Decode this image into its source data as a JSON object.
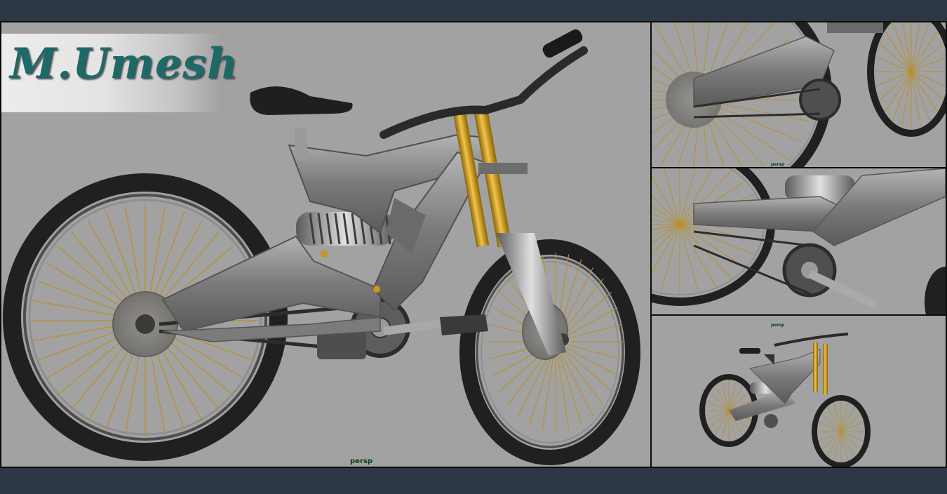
{
  "logo": {
    "text": "M.Umesh"
  },
  "viewports": {
    "main": {
      "camera_label": "persp"
    },
    "top_right": {
      "camera_label": "persp"
    },
    "middle_right": {
      "camera_label": ""
    },
    "bottom_right": {
      "camera_label": "persp"
    }
  },
  "colors": {
    "background": "#2e3744",
    "viewport_bg": "#a2a2a2",
    "viewport_border": "#0b0b0b",
    "label_color": "#064013",
    "logo_color": "#1c6a68",
    "fork_gold": "#c9961d",
    "frame_gray": "#8a8a8a",
    "tire_black": "#1e1e1e",
    "spoke_gold": "#b8902a"
  }
}
